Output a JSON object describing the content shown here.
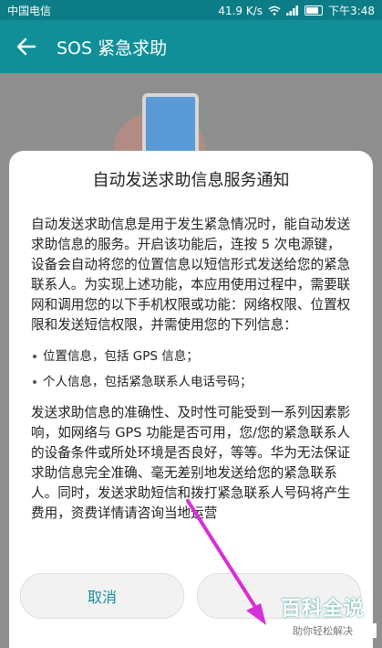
{
  "status_bar": {
    "carrier": "中国电信",
    "speed": "41.9 K/s",
    "time": "下午3:48"
  },
  "app_bar": {
    "title": "SOS 紧急求助"
  },
  "dialog": {
    "title": "自动发送求助信息服务通知",
    "paragraph1": "自动发送求助信息是用于发生紧急情况时，能自动发送求助信息的服务。开启该功能后，连按 5 次电源键，设备会自动将您的位置信息以短信形式发送给您的紧急联系人。为实现上述功能，本应用使用过程中，需要联网和调用您的以下手机权限或功能：网络权限、位置权限和发送短信权限，并需使用您的下列信息：",
    "bullets": [
      "位置信息，包括 GPS 信息；",
      "个人信息，包括紧急联系人电话号码；"
    ],
    "paragraph2": "发送求助信息的准确性、及时性可能受到一系列因素影响，如网络与 GPS 功能是否可用，您/您的紧急联系人的设备条件或所处环境是否良好，等等。华为无法保证求助信息完全准确、毫无差别地发送给您的紧急联系人。同时，发送求助短信和拨打紧急联系人号码将产生费用，资费详情请咨询当地运营",
    "cancel_label": "取消"
  },
  "watermark": {
    "main": "百科全说",
    "sub": "助你轻松解决"
  }
}
